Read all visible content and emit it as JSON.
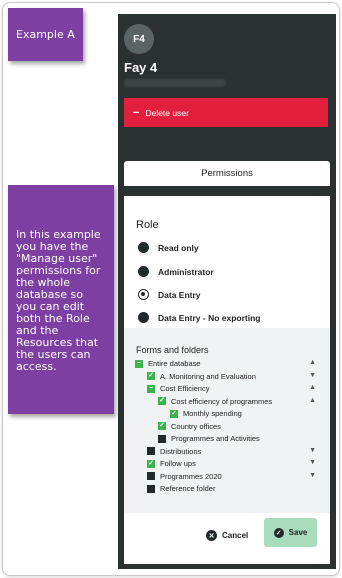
{
  "callouts": {
    "a": "Example A",
    "b": "In this example you have the \"Manage user\" permissions for the whole database so you can edit both the Role and the Resources that the users can access."
  },
  "user": {
    "initials": "F4",
    "name": "Fay 4"
  },
  "delete_label": "Delete user",
  "tab_label": "Permissions",
  "role": {
    "heading": "Role",
    "options": [
      {
        "label": "Read only",
        "selected": false
      },
      {
        "label": "Administrator",
        "selected": false
      },
      {
        "label": "Data Entry",
        "selected": true
      },
      {
        "label": "Data Entry - No exporting",
        "selected": false
      }
    ]
  },
  "forms": {
    "heading": "Forms and folders",
    "items": [
      {
        "label": "Entire database",
        "state": "partial",
        "arrow": "up"
      },
      {
        "label": "A. Monitoring and Evaluation",
        "state": "checked",
        "arrow": "down"
      },
      {
        "label": "Cost Efficiency",
        "state": "partial",
        "arrow": "up"
      },
      {
        "label": "Cost efficiency of programmes",
        "state": "checked",
        "arrow": "up"
      },
      {
        "label": "Monthly spending",
        "state": "checked",
        "arrow": ""
      },
      {
        "label": "Country offices",
        "state": "checked",
        "arrow": ""
      },
      {
        "label": "Programmes and Activities",
        "state": "empty",
        "arrow": ""
      },
      {
        "label": "Distributions",
        "state": "empty",
        "arrow": "down"
      },
      {
        "label": "Follow ups",
        "state": "checked",
        "arrow": "down"
      },
      {
        "label": "Programmes 2020",
        "state": "empty",
        "arrow": "down"
      },
      {
        "label": "Reference folder",
        "state": "empty",
        "arrow": ""
      }
    ]
  },
  "actions": {
    "cancel": "Cancel",
    "save": "Save"
  },
  "colors": {
    "callout": "#7e3fa3",
    "danger": "#e21f3c",
    "check": "#3bb34a",
    "save": "#a9dbbd",
    "panel": "#2b3131"
  }
}
